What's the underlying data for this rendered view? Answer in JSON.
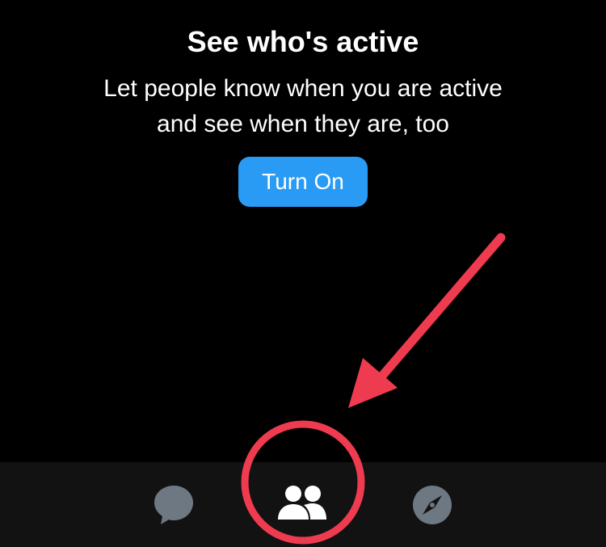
{
  "header": {
    "title": "See who's active",
    "subtitle_line1": "Let people know when you are active",
    "subtitle_line2": "and see when they are, too"
  },
  "actions": {
    "turn_on_label": "Turn On"
  },
  "tabbar": {
    "tabs": [
      {
        "icon": "chat-bubble-icon",
        "active": false
      },
      {
        "icon": "people-icon",
        "active": true
      },
      {
        "icon": "compass-icon",
        "active": false
      }
    ]
  },
  "colors": {
    "background": "#000000",
    "tabbar_background": "#121212",
    "accent": "#2a9bf5",
    "inactive_icon": "#6e7882",
    "active_icon": "#ffffff",
    "annotation": "#ef3b4f"
  }
}
